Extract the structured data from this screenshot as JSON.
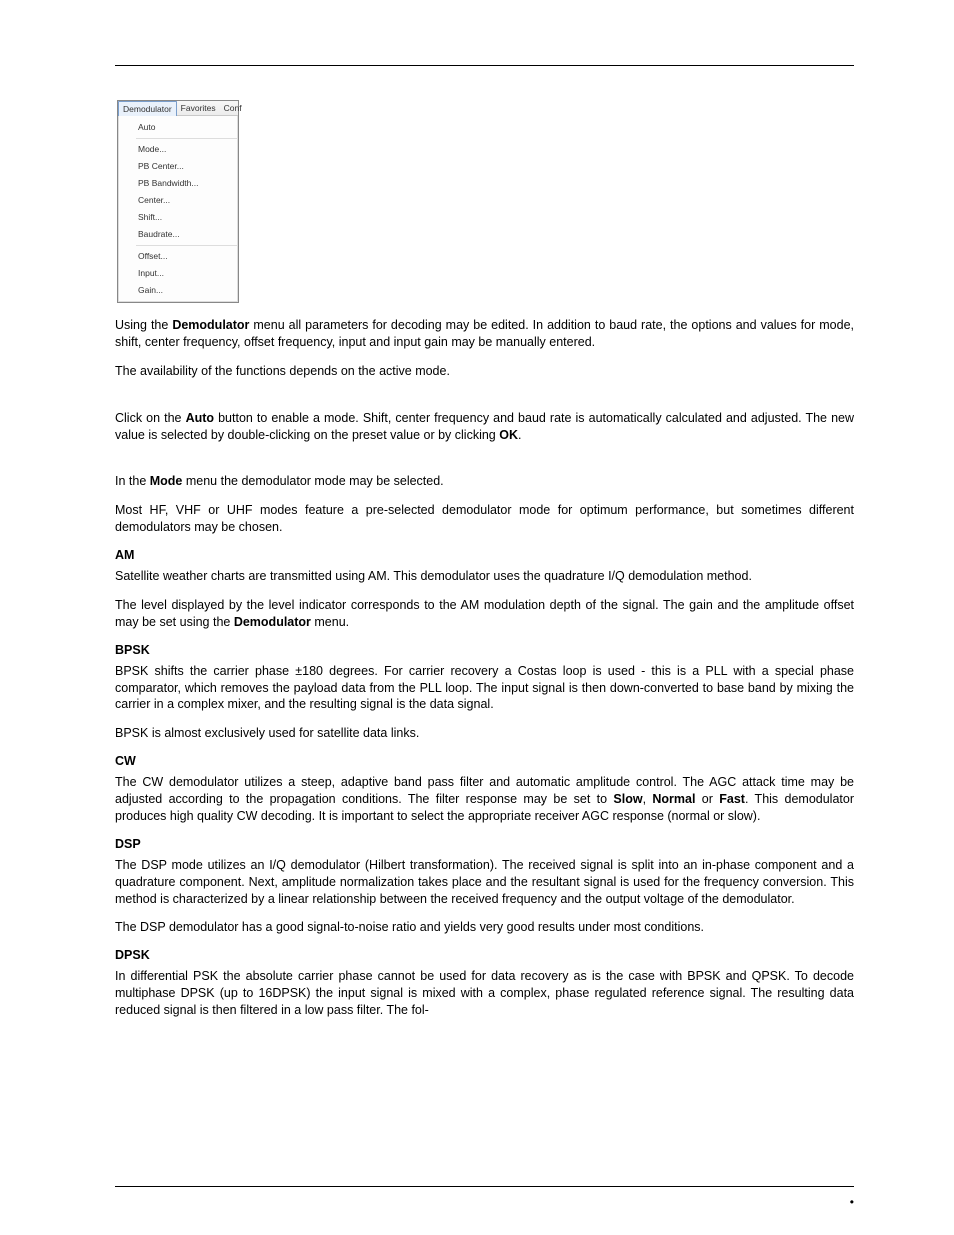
{
  "menu": {
    "tabs": [
      "Demodulator",
      "Favorites",
      "Conf"
    ],
    "items_a": [
      "Auto",
      "Mode...",
      "PB Center...",
      "PB Bandwidth...",
      "Center...",
      "Shift...",
      "Baudrate..."
    ],
    "items_b": [
      "Offset...",
      "Input...",
      "Gain..."
    ]
  },
  "para": {
    "p1a": "Using the ",
    "p1b": "Demodulator",
    "p1c": " menu all parameters for decoding may be edited. In addition to baud rate, the options and values for mode, shift, center frequency, offset frequency, input and input gain may be manually entered.",
    "p2": "The availability of the functions depends on the active mode.",
    "p3a": "Click on the ",
    "p3b": "Auto",
    "p3c": " button to enable a mode. Shift, center frequency and baud rate is automatically calculated and adjusted. The new value is selected by double-clicking on the preset value or by clicking ",
    "p3d": "OK",
    "p3e": ".",
    "p4a": "In the ",
    "p4b": "Mode",
    "p4c": " menu the demodulator mode may be selected.",
    "p5": "Most HF, VHF or UHF modes feature a pre-selected demodulator mode for optimum performance, but sometimes different demodulators may be chosen.",
    "am": "AM",
    "p6": "Satellite weather charts are transmitted using AM. This demodulator uses the quadrature I/Q demodulation method.",
    "p7a": "The level displayed by the level indicator corresponds to the AM modulation depth of the signal. The gain and the amplitude offset may be set using the ",
    "p7b": "Demodulator",
    "p7c": " menu.",
    "bpsk": "BPSK",
    "p8": "BPSK shifts the carrier phase ±180 degrees. For carrier recovery a Costas loop is used - this is a PLL with a special phase comparator, which removes the payload data from the PLL loop. The input signal is then down-converted to base band by mixing the carrier in a complex mixer, and the resulting signal is the data signal.",
    "p9": "BPSK is almost exclusively used for satellite data links.",
    "cw": "CW",
    "p10a": "The CW demodulator utilizes a steep, adaptive band pass filter and automatic amplitude control. The AGC attack time may be adjusted according to the propagation conditions. The filter response may be set to ",
    "p10b": "Slow",
    "p10c": ", ",
    "p10d": "Normal",
    "p10e": " or ",
    "p10f": "Fast",
    "p10g": ". This demodulator produces high quality CW decoding. It is important to select the appropriate receiver AGC response (normal or slow).",
    "dsp": "DSP",
    "p11": "The DSP mode utilizes an I/Q demodulator (Hilbert transformation). The received signal is split into an in-phase component and a quadrature component. Next, amplitude normalization takes place and the resultant signal is used for the frequency conversion. This method is characterized by a linear relationship between the received frequency and the output voltage of the demodulator.",
    "p12": "The DSP demodulator has a good signal-to-noise ratio and yields very good results under most conditions.",
    "dpsk": "DPSK",
    "p13": "In differential PSK the absolute carrier phase cannot be used for data recovery as is the case with BPSK and QPSK. To decode multiphase DPSK (up to 16DPSK) the input signal is mixed with a complex, phase regulated reference signal. The resulting data reduced signal is then filtered in a low pass filter. The fol-"
  },
  "footer_dot": "•"
}
